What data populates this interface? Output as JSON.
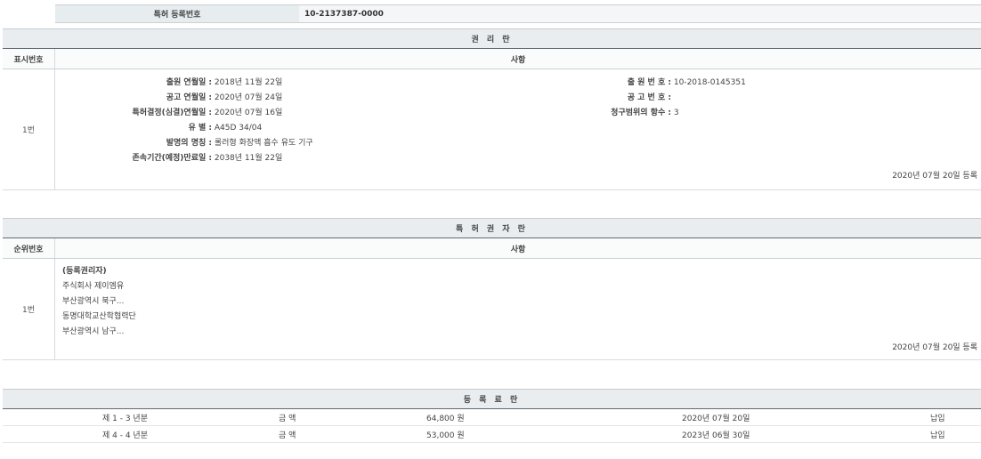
{
  "patent_no": {
    "label": "특허 등록번호",
    "value": "10-2137387-0000"
  },
  "rights": {
    "title": "권 리 란",
    "col_no": "표시번호",
    "col_matter": "사항",
    "row_no": "1번",
    "left": [
      {
        "k": "출원 연월일 :",
        "v": "2018년 11월 22일"
      },
      {
        "k": "공고 연월일 :",
        "v": "2020년 07월 24일"
      },
      {
        "k": "특허결정(심결)연월일 :",
        "v": "2020년 07월 16일"
      },
      {
        "k": "유 별 :",
        "v": "A45D 34/04"
      },
      {
        "k": "발명의 명칭 :",
        "v": "롤러형 화장액 흡수 유도 기구"
      },
      {
        "k": "존속기간(예정)만료일 :",
        "v": "2038년 11월 22일"
      }
    ],
    "right": [
      {
        "k": "출 원 번 호 :",
        "v": "10-2018-0145351"
      },
      {
        "k": "공 고 번 호 :",
        "v": ""
      },
      {
        "k": "청구범위의 항수 :",
        "v": "3"
      }
    ],
    "stamp": "2020년 07월 20일 등록"
  },
  "owners": {
    "title": "특 허 권 자 란",
    "col_no": "순위번호",
    "col_matter": "사항",
    "row_no": "1번",
    "lines": [
      "(등록권리자)",
      "주식회사 제이엠유",
      "부산광역시 북구...",
      "동명대학교산학협력단",
      "부산광역시 남구..."
    ],
    "stamp": "2020년 07월 20일 등록"
  },
  "fees": {
    "title": "등 록 료 란",
    "rows": [
      {
        "period": "제 1 - 3 년분",
        "label": "금 액",
        "amount": "64,800 원",
        "date": "2020년 07월 20일",
        "status": "납입"
      },
      {
        "period": "제 4 - 4 년분",
        "label": "금 액",
        "amount": "53,000 원",
        "date": "2023년 06월 30일",
        "status": "납입"
      }
    ]
  }
}
